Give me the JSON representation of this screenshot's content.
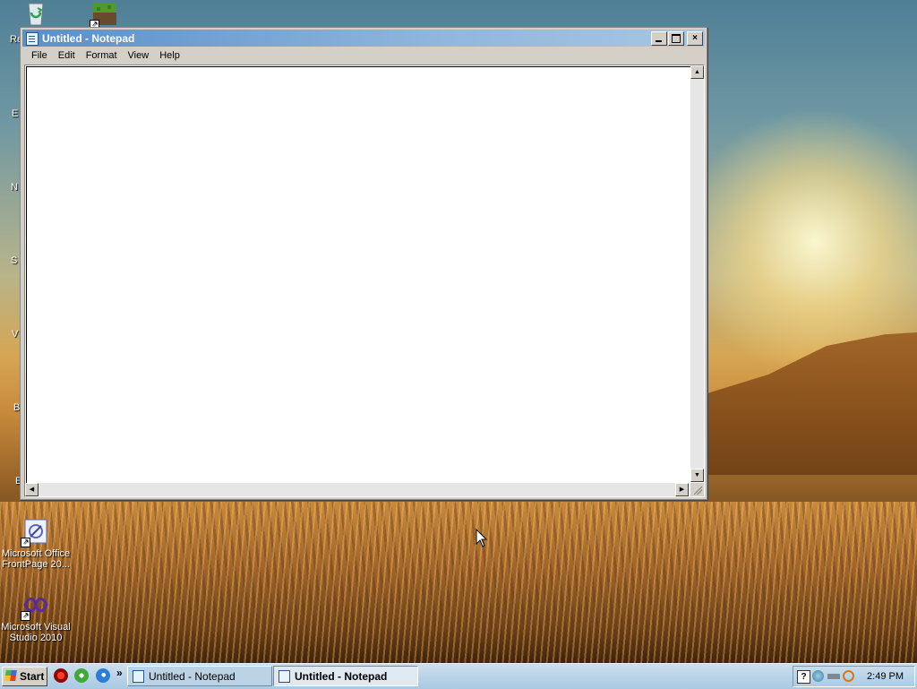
{
  "desktop": {
    "letters": [
      "Re",
      "E",
      "N",
      "S",
      "V",
      "B",
      "E"
    ],
    "icons": [
      {
        "name": "recycle-bin-icon",
        "label": ""
      },
      {
        "name": "minecraft-shortcut-icon",
        "label": ""
      },
      {
        "name": "frontpage-shortcut-icon",
        "label": "Microsoft Office FrontPage 20..."
      },
      {
        "name": "visual-studio-shortcut-icon",
        "label": "Microsoft Visual Studio 2010"
      }
    ]
  },
  "window": {
    "title": "Untitled - Notepad",
    "buttons": {
      "minimize": "minimize",
      "maximize": "maximize",
      "close": "×"
    },
    "menu": [
      "File",
      "Edit",
      "Format",
      "View",
      "Help"
    ],
    "content": ""
  },
  "taskbar": {
    "start_label": "Start",
    "quick_launch": [
      "media-player-icon",
      "messenger-icon",
      "internet-explorer-icon"
    ],
    "chevron": "»",
    "tasks": [
      {
        "label": "Untitled - Notepad",
        "active": false
      },
      {
        "label": "Untitled - Notepad",
        "active": true
      }
    ],
    "tray": {
      "help": "?",
      "clock": "2:49 PM"
    }
  },
  "colors": {
    "titlebar_start": "#5a8fc8",
    "titlebar_end": "#a8c6e3",
    "taskbar": "#a9c9e3"
  }
}
